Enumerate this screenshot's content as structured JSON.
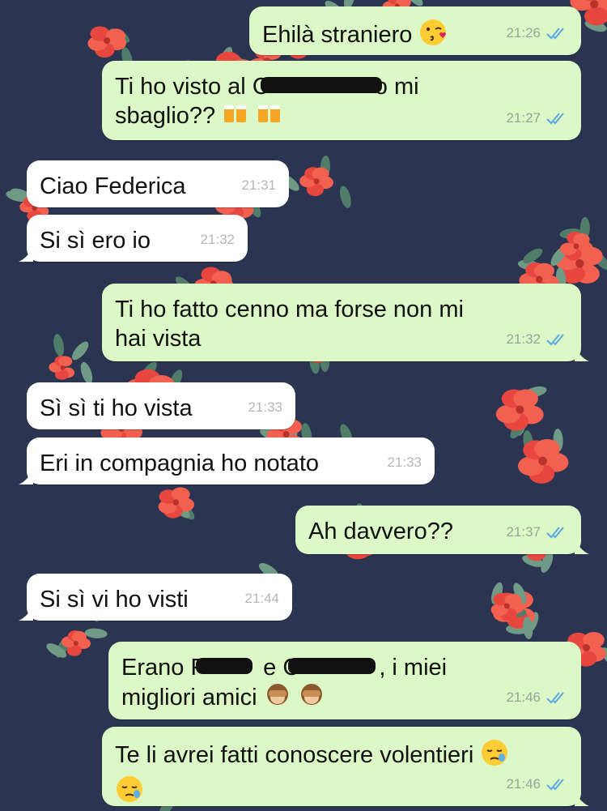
{
  "colors": {
    "outgoing_bubble": "#dcf8c6",
    "incoming_bubble": "#ffffff",
    "read_ticks": "#5aa8e6",
    "wallpaper": "#2b3450"
  },
  "wallpaper": {
    "pattern": "red flowers on dark navy"
  },
  "messages": [
    {
      "dir": "out",
      "lines": [
        "Ehilà straniero"
      ],
      "emoji": "kissing-face-with-heart-emoji",
      "time": "21:26",
      "ticks": "read-double-check"
    },
    {
      "dir": "out",
      "lines": [
        "Ti ho visto al C",
        "o mi",
        "sbaglio??"
      ],
      "emoji": "beer-mugs-emoji",
      "time": "21:27",
      "ticks": "read-double-check",
      "redacted": "name scribbled out"
    },
    {
      "dir": "in",
      "lines": [
        "Ciao Federica"
      ],
      "time": "21:31"
    },
    {
      "dir": "in",
      "lines": [
        "Si sì ero io"
      ],
      "time": "21:32"
    },
    {
      "dir": "out",
      "lines": [
        "Ti ho fatto cenno ma forse non mi",
        "hai vista"
      ],
      "time": "21:32",
      "ticks": "read-double-check"
    },
    {
      "dir": "in",
      "lines": [
        "Sì sì ti ho vista"
      ],
      "time": "21:33"
    },
    {
      "dir": "in",
      "lines": [
        "Eri in compagnia ho notato"
      ],
      "time": "21:33"
    },
    {
      "dir": "out",
      "lines": [
        "Ah davvero??"
      ],
      "time": "21:37",
      "ticks": "read-double-check"
    },
    {
      "dir": "in",
      "lines": [
        "Si sì vi ho visti"
      ],
      "time": "21:44"
    },
    {
      "dir": "out",
      "lines": [
        "Erano F",
        "e C",
        ", i miei",
        "migliori amici"
      ],
      "emoji": "see-no-evil-monkey-emoji",
      "time": "21:46",
      "ticks": "read-double-check",
      "redacted": "names scribbled out"
    },
    {
      "dir": "out",
      "lines": [
        "Te li avrei fatti conoscere volentieri"
      ],
      "emoji": "sleepy-face-emoji",
      "time": "21:46",
      "ticks": "read-double-check"
    }
  ]
}
